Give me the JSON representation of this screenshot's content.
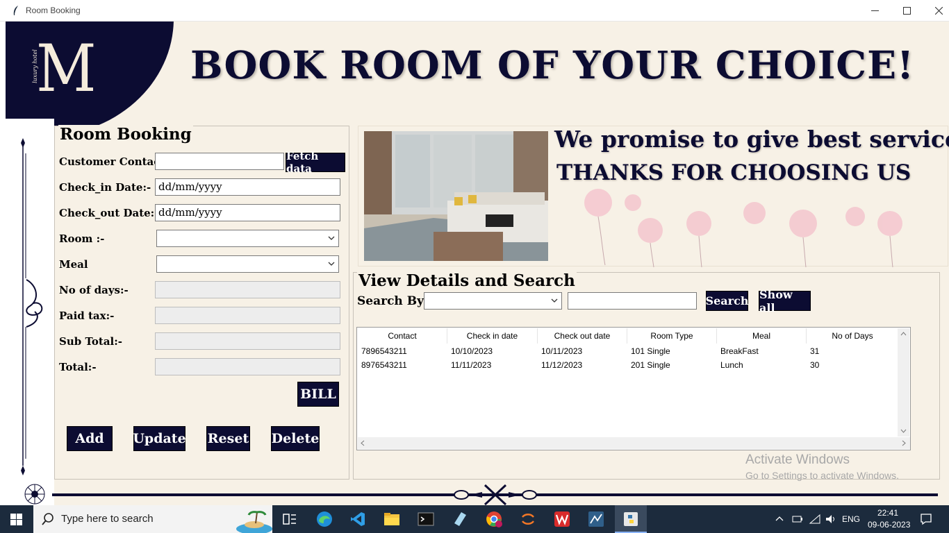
{
  "window": {
    "title": "Room Booking"
  },
  "header": {
    "headline": "BOOK ROOM OF YOUR CHOICE!",
    "logo_letter": "M",
    "logo_script": "luxury hotel"
  },
  "booking": {
    "title": "Room Booking",
    "contact_label": "Customer Contact:-",
    "fetch_label": "Fetch data",
    "checkin_label": "Check_in Date:-",
    "checkin_value": "dd/mm/yyyy",
    "checkout_label": "Check_out Date:-",
    "checkout_value": "dd/mm/yyyy",
    "room_label": "Room :-",
    "meal_label": "Meal",
    "days_label": "No of days:-",
    "tax_label": "Paid tax:-",
    "subtotal_label": "Sub Total:-",
    "total_label": "Total:-",
    "bill_label": "BILL",
    "add_label": "Add",
    "update_label": "Update",
    "reset_label": "Reset",
    "delete_label": "Delete"
  },
  "banner": {
    "line1": "We promise to give best services,",
    "line2": "THANKS FOR CHOOSING US"
  },
  "search": {
    "title": "View Details and Search",
    "by_label": "Search By:",
    "search_label": "Search",
    "showall_label": "Show all"
  },
  "table": {
    "columns": [
      "Contact",
      "Check in date",
      "Check out date",
      "Room Type",
      "Meal",
      "No of Days"
    ],
    "rows": [
      [
        "7896543211",
        "10/10/2023",
        "10/11/2023",
        "101 Single",
        "BreakFast",
        "31"
      ],
      [
        "8976543211",
        "11/11/2023",
        "11/12/2023",
        "201 Single",
        "Lunch",
        "30"
      ]
    ]
  },
  "watermark": {
    "line1": "Activate Windows",
    "line2": "Go to Settings to activate Windows."
  },
  "taskbar": {
    "search_placeholder": "Type here to search",
    "lang": "ENG",
    "time": "22:41",
    "date": "09-06-2023"
  },
  "colors": {
    "navy": "#0c0c32",
    "cream": "#f7f1e6"
  }
}
